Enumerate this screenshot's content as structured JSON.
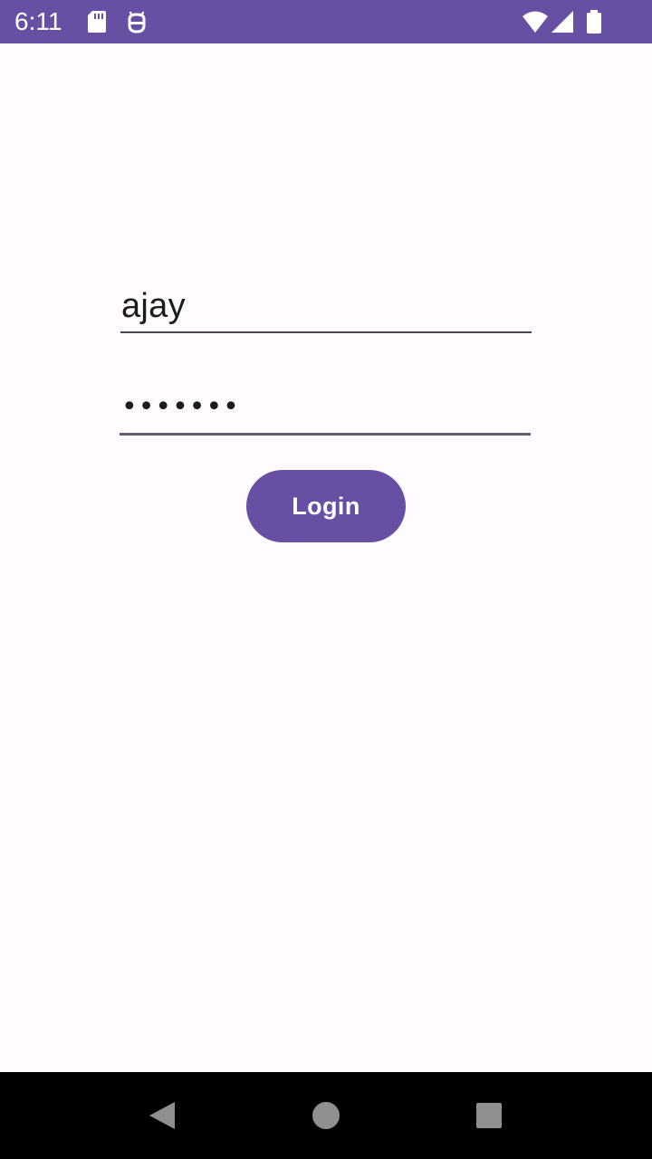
{
  "status_bar": {
    "time": "6:11",
    "background_color": "#6750a4",
    "icons": [
      "sd-card-icon",
      "debug-icon",
      "wifi-icon",
      "signal-icon",
      "battery-icon"
    ]
  },
  "login_form": {
    "username_value": "ajay",
    "password_masked": "•••••••",
    "login_label": "Login",
    "accent_color": "#6750a4"
  },
  "navigation_bar": {
    "buttons": [
      "back-icon",
      "home-icon",
      "recents-icon"
    ]
  }
}
